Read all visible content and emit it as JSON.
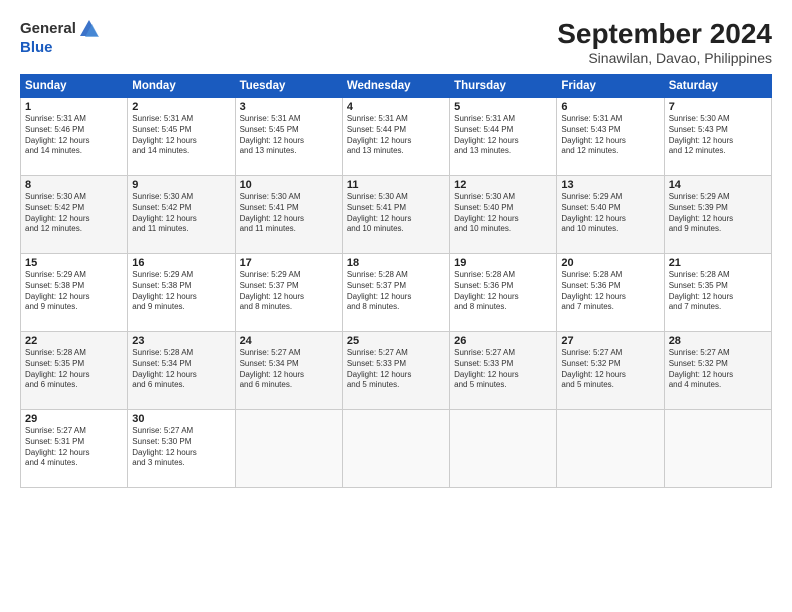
{
  "header": {
    "logo_general": "General",
    "logo_blue": "Blue",
    "month": "September 2024",
    "location": "Sinawilan, Davao, Philippines"
  },
  "weekdays": [
    "Sunday",
    "Monday",
    "Tuesday",
    "Wednesday",
    "Thursday",
    "Friday",
    "Saturday"
  ],
  "weeks": [
    [
      {
        "day": "1",
        "lines": [
          "Sunrise: 5:31 AM",
          "Sunset: 5:46 PM",
          "Daylight: 12 hours",
          "and 14 minutes."
        ]
      },
      {
        "day": "2",
        "lines": [
          "Sunrise: 5:31 AM",
          "Sunset: 5:45 PM",
          "Daylight: 12 hours",
          "and 14 minutes."
        ]
      },
      {
        "day": "3",
        "lines": [
          "Sunrise: 5:31 AM",
          "Sunset: 5:45 PM",
          "Daylight: 12 hours",
          "and 13 minutes."
        ]
      },
      {
        "day": "4",
        "lines": [
          "Sunrise: 5:31 AM",
          "Sunset: 5:44 PM",
          "Daylight: 12 hours",
          "and 13 minutes."
        ]
      },
      {
        "day": "5",
        "lines": [
          "Sunrise: 5:31 AM",
          "Sunset: 5:44 PM",
          "Daylight: 12 hours",
          "and 13 minutes."
        ]
      },
      {
        "day": "6",
        "lines": [
          "Sunrise: 5:31 AM",
          "Sunset: 5:43 PM",
          "Daylight: 12 hours",
          "and 12 minutes."
        ]
      },
      {
        "day": "7",
        "lines": [
          "Sunrise: 5:30 AM",
          "Sunset: 5:43 PM",
          "Daylight: 12 hours",
          "and 12 minutes."
        ]
      }
    ],
    [
      {
        "day": "8",
        "lines": [
          "Sunrise: 5:30 AM",
          "Sunset: 5:42 PM",
          "Daylight: 12 hours",
          "and 12 minutes."
        ]
      },
      {
        "day": "9",
        "lines": [
          "Sunrise: 5:30 AM",
          "Sunset: 5:42 PM",
          "Daylight: 12 hours",
          "and 11 minutes."
        ]
      },
      {
        "day": "10",
        "lines": [
          "Sunrise: 5:30 AM",
          "Sunset: 5:41 PM",
          "Daylight: 12 hours",
          "and 11 minutes."
        ]
      },
      {
        "day": "11",
        "lines": [
          "Sunrise: 5:30 AM",
          "Sunset: 5:41 PM",
          "Daylight: 12 hours",
          "and 10 minutes."
        ]
      },
      {
        "day": "12",
        "lines": [
          "Sunrise: 5:30 AM",
          "Sunset: 5:40 PM",
          "Daylight: 12 hours",
          "and 10 minutes."
        ]
      },
      {
        "day": "13",
        "lines": [
          "Sunrise: 5:29 AM",
          "Sunset: 5:40 PM",
          "Daylight: 12 hours",
          "and 10 minutes."
        ]
      },
      {
        "day": "14",
        "lines": [
          "Sunrise: 5:29 AM",
          "Sunset: 5:39 PM",
          "Daylight: 12 hours",
          "and 9 minutes."
        ]
      }
    ],
    [
      {
        "day": "15",
        "lines": [
          "Sunrise: 5:29 AM",
          "Sunset: 5:38 PM",
          "Daylight: 12 hours",
          "and 9 minutes."
        ]
      },
      {
        "day": "16",
        "lines": [
          "Sunrise: 5:29 AM",
          "Sunset: 5:38 PM",
          "Daylight: 12 hours",
          "and 9 minutes."
        ]
      },
      {
        "day": "17",
        "lines": [
          "Sunrise: 5:29 AM",
          "Sunset: 5:37 PM",
          "Daylight: 12 hours",
          "and 8 minutes."
        ]
      },
      {
        "day": "18",
        "lines": [
          "Sunrise: 5:28 AM",
          "Sunset: 5:37 PM",
          "Daylight: 12 hours",
          "and 8 minutes."
        ]
      },
      {
        "day": "19",
        "lines": [
          "Sunrise: 5:28 AM",
          "Sunset: 5:36 PM",
          "Daylight: 12 hours",
          "and 8 minutes."
        ]
      },
      {
        "day": "20",
        "lines": [
          "Sunrise: 5:28 AM",
          "Sunset: 5:36 PM",
          "Daylight: 12 hours",
          "and 7 minutes."
        ]
      },
      {
        "day": "21",
        "lines": [
          "Sunrise: 5:28 AM",
          "Sunset: 5:35 PM",
          "Daylight: 12 hours",
          "and 7 minutes."
        ]
      }
    ],
    [
      {
        "day": "22",
        "lines": [
          "Sunrise: 5:28 AM",
          "Sunset: 5:35 PM",
          "Daylight: 12 hours",
          "and 6 minutes."
        ]
      },
      {
        "day": "23",
        "lines": [
          "Sunrise: 5:28 AM",
          "Sunset: 5:34 PM",
          "Daylight: 12 hours",
          "and 6 minutes."
        ]
      },
      {
        "day": "24",
        "lines": [
          "Sunrise: 5:27 AM",
          "Sunset: 5:34 PM",
          "Daylight: 12 hours",
          "and 6 minutes."
        ]
      },
      {
        "day": "25",
        "lines": [
          "Sunrise: 5:27 AM",
          "Sunset: 5:33 PM",
          "Daylight: 12 hours",
          "and 5 minutes."
        ]
      },
      {
        "day": "26",
        "lines": [
          "Sunrise: 5:27 AM",
          "Sunset: 5:33 PM",
          "Daylight: 12 hours",
          "and 5 minutes."
        ]
      },
      {
        "day": "27",
        "lines": [
          "Sunrise: 5:27 AM",
          "Sunset: 5:32 PM",
          "Daylight: 12 hours",
          "and 5 minutes."
        ]
      },
      {
        "day": "28",
        "lines": [
          "Sunrise: 5:27 AM",
          "Sunset: 5:32 PM",
          "Daylight: 12 hours",
          "and 4 minutes."
        ]
      }
    ],
    [
      {
        "day": "29",
        "lines": [
          "Sunrise: 5:27 AM",
          "Sunset: 5:31 PM",
          "Daylight: 12 hours",
          "and 4 minutes."
        ]
      },
      {
        "day": "30",
        "lines": [
          "Sunrise: 5:27 AM",
          "Sunset: 5:30 PM",
          "Daylight: 12 hours",
          "and 3 minutes."
        ]
      },
      {
        "day": "",
        "lines": []
      },
      {
        "day": "",
        "lines": []
      },
      {
        "day": "",
        "lines": []
      },
      {
        "day": "",
        "lines": []
      },
      {
        "day": "",
        "lines": []
      }
    ]
  ]
}
